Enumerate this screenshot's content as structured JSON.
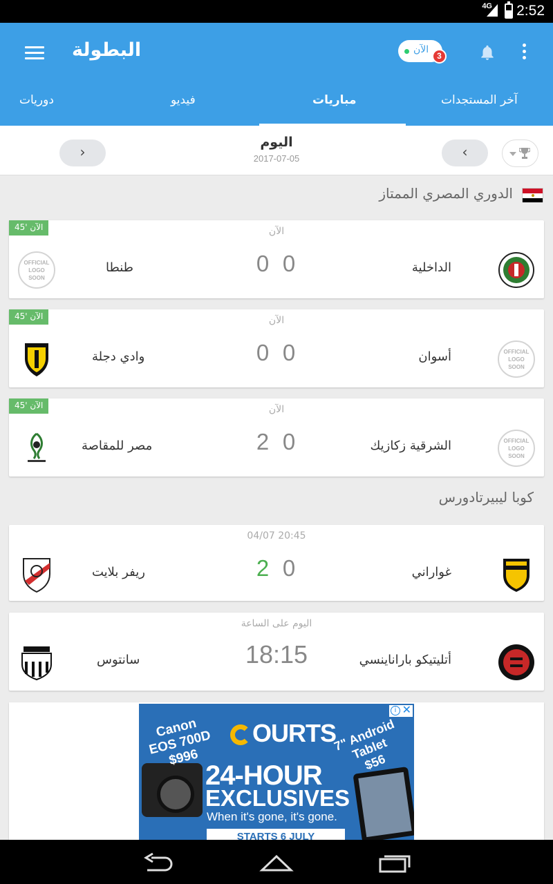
{
  "status_bar": {
    "network": "4G",
    "time": "2:52"
  },
  "app_bar": {
    "brand": "البطولة",
    "live_pill_label": "الآن",
    "live_badge_count": "3",
    "icons": [
      "menu-icon",
      "bell-icon",
      "more-vert-icon"
    ]
  },
  "tabs": [
    {
      "label": "آخر المستجدات"
    },
    {
      "label": "مباريات"
    },
    {
      "label": "فيديو"
    },
    {
      "label": "دوريات"
    }
  ],
  "active_tab_index": 1,
  "date_bar": {
    "title": "اليوم",
    "date": "2017-07-05",
    "prev_glyph": "‹",
    "next_glyph": "›"
  },
  "leagues": [
    {
      "name": "الدوري المصري الممتاز",
      "flag": "egypt-flag",
      "matches": [
        {
          "live_tag": "الآن '45",
          "status": "الآن",
          "home": "الداخلية",
          "away": "طنطا",
          "home_score": "0",
          "away_score": "0"
        },
        {
          "live_tag": "الآن '45",
          "status": "الآن",
          "home": "أسوان",
          "away": "وادي دجلة",
          "home_score": "0",
          "away_score": "0"
        },
        {
          "live_tag": "الآن '45",
          "status": "الآن",
          "home": "الشرقية زكازيك",
          "away": "مصر للمقاصة",
          "home_score": "0",
          "away_score": "2"
        }
      ]
    },
    {
      "name": "كوبا ليبيرتادورس",
      "matches": [
        {
          "status": "04/07 20:45",
          "home": "غواراني",
          "away": "ريفر بلايت",
          "home_score": "0",
          "away_score": "2"
        },
        {
          "status": "اليوم على الساعة",
          "home": "أتليتيكو باراناينسي",
          "away": "سانتوس",
          "kickoff": "18:15"
        }
      ]
    }
  ],
  "placeholder_logo": {
    "l1": "OFFICIAL",
    "l2": "LOGO",
    "l3": "SOON"
  },
  "ad": {
    "close": "✕",
    "info": "i",
    "camera_text_1": "Canon",
    "camera_text_2": "EOS 700D",
    "camera_price": "$996",
    "brand": "OURTS",
    "tablet_text_1": "7\" Android",
    "tablet_text_2": "Tablet",
    "tablet_price": "$56",
    "headline_1": "24-HOUR",
    "headline_2": "EXCLUSIVES",
    "tagline": "When it's gone, it's gone.",
    "starts": "STARTS 6 JULY"
  },
  "colors": {
    "appbar": "#3d9fe6",
    "live_green": "#66bb6a",
    "win_green": "#4caf50",
    "badge_red": "#e53935"
  }
}
